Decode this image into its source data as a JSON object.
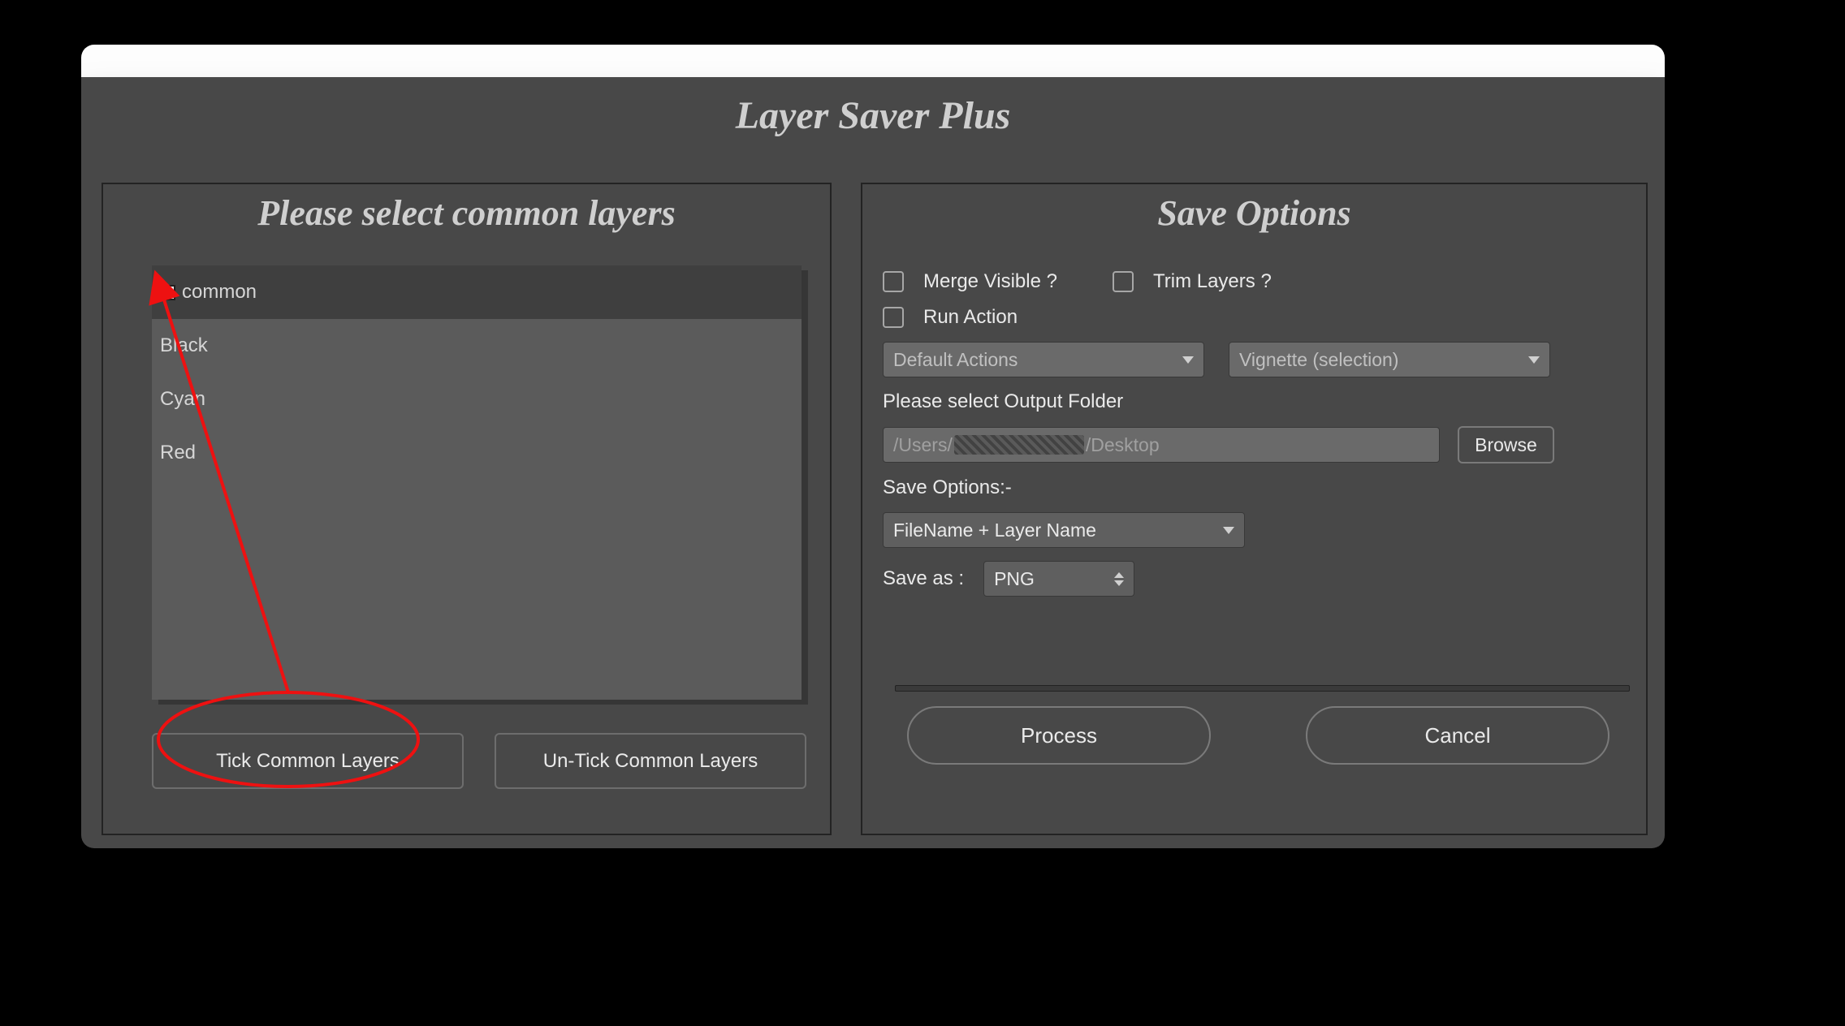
{
  "app": {
    "title": "Layer Saver Plus"
  },
  "left": {
    "heading": "Please select common layers",
    "layers": [
      {
        "name": "common",
        "checked": false,
        "selected": true,
        "hasCheckbox": true
      },
      {
        "name": "Black",
        "checked": false,
        "selected": false,
        "hasCheckbox": false
      },
      {
        "name": "Cyan",
        "checked": false,
        "selected": false,
        "hasCheckbox": false
      },
      {
        "name": "Red",
        "checked": false,
        "selected": false,
        "hasCheckbox": false
      }
    ],
    "tick_btn": "Tick Common Layers",
    "untick_btn": "Un-Tick Common Layers"
  },
  "right": {
    "heading": "Save Options",
    "merge_label": "Merge Visible ?",
    "trim_label": "Trim Layers ?",
    "run_label": "Run Action",
    "action_set": "Default Actions",
    "action_name": "Vignette (selection)",
    "output_label": "Please select Output Folder",
    "output_path_prefix": "/Users/",
    "output_path_suffix": "/Desktop",
    "browse": "Browse",
    "saveopts_label": "Save Options:-",
    "naming": "FileName + Layer Name",
    "saveas_label": "Save as :",
    "format": "PNG",
    "process": "Process",
    "cancel": "Cancel"
  }
}
